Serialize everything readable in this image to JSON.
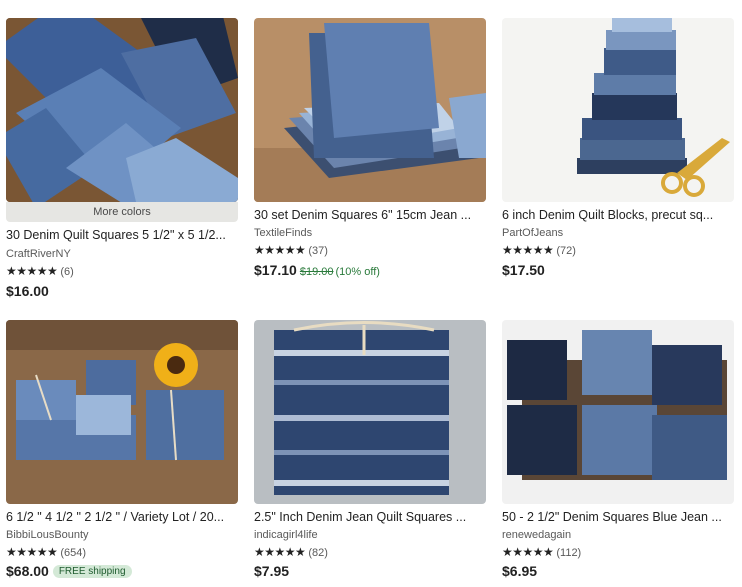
{
  "listings": [
    {
      "title": "30 Denim Quilt Squares 5 1/2\" x 5 1/2...",
      "shop": "CraftRiverNY",
      "stars": "★★★★★",
      "reviews": "(6)",
      "price": "$16.00",
      "overlay": "More colors"
    },
    {
      "title": "30 set Denim Squares 6\" 15cm Jean ...",
      "shop": "TextileFinds",
      "stars": "★★★★★",
      "reviews": "(37)",
      "price": "$17.10",
      "original_price": "$19.00",
      "discount": "(10% off)"
    },
    {
      "title": "6 inch Denim Quilt Blocks, precut sq...",
      "shop": "PartOfJeans",
      "stars": "★★★★★",
      "reviews": "(72)",
      "price": "$17.50"
    },
    {
      "title": "6 1/2 \" 4 1/2 \" 2 1/2 \" / Variety Lot / 20...",
      "shop": "BibbiLousBounty",
      "stars": "★★★★★",
      "reviews": "(654)",
      "price": "$68.00",
      "badge": "FREE shipping"
    },
    {
      "title": "2.5\" Inch Denim Jean Quilt Squares ...",
      "shop": "indicagirl4life",
      "stars": "★★★★★",
      "reviews": "(82)",
      "price": "$7.95"
    },
    {
      "title": "50 - 2 1/2\" Denim Squares Blue Jean ...",
      "shop": "renewedagain",
      "stars": "★★★★★",
      "reviews": "(112)",
      "price": "$6.95"
    }
  ],
  "colors": {
    "sale_green": "#2a7a3b",
    "badge_bg": "#d4e9d7",
    "denim_light": "#7fa0c9",
    "denim_mid": "#4f72a4",
    "denim_dark": "#23324f"
  }
}
